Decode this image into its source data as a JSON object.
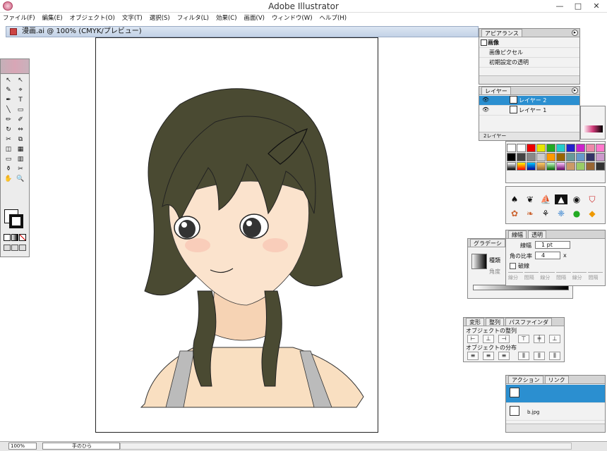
{
  "window": {
    "title": "Adobe Illustrator",
    "min": "—",
    "max": "□",
    "close": "✕"
  },
  "menu": [
    "ファイル(F)",
    "編集(E)",
    "オブジェクト(O)",
    "文字(T)",
    "選択(S)",
    "フィルタ(L)",
    "効果(C)",
    "画面(V)",
    "ウィンドウ(W)",
    "ヘルプ(H)"
  ],
  "document": {
    "tab_title": "漫画.ai @ 100% (CMYK/プレビュー)"
  },
  "status": {
    "zoom": "100%",
    "tool": "手のひら"
  },
  "toolbox": {
    "tools": [
      "↖",
      "↖",
      "✎",
      "⌖",
      "✒",
      "T",
      "╲",
      "▭",
      "✏",
      "✐",
      "↻",
      "⇔",
      "✂",
      "⧉",
      "◫",
      "▦",
      "▭",
      "▥",
      "⚱",
      "✂",
      "✋",
      "🔍"
    ]
  },
  "appearance": {
    "tab": "アピアランス",
    "title": "画像",
    "rows": [
      "画像ピクセル",
      "初期設定の透明"
    ]
  },
  "layers": {
    "tab": "レイヤー",
    "items": [
      "レイヤー 2",
      "レイヤー 1"
    ],
    "footer": "2レイヤー"
  },
  "stroke": {
    "tabs": [
      "線幅",
      "透明"
    ],
    "weight_label": "線幅",
    "weight_value": "1 pt",
    "miter_label": "角の比率",
    "miter_value": "4",
    "miter_unit": "x",
    "dashed_label": "破線",
    "dash_labels": [
      "線分",
      "間隔",
      "線分",
      "間隔",
      "線分",
      "間隔"
    ]
  },
  "gradient": {
    "tab": "グラデーシ",
    "type_label": "種類",
    "angle_label": "角度"
  },
  "align": {
    "tabs": [
      "変形",
      "整列",
      "パスファインダ"
    ],
    "section1": "オブジェクトの整列",
    "section2": "オブジェクトの分布"
  },
  "actions": {
    "tabs": [
      "アクション",
      "リンク"
    ],
    "file": "b.jpg"
  },
  "colors": {
    "brand": "#c8577a",
    "selection": "#2b8fd0",
    "hair": "#4a4a32",
    "skin": "#f9dfc1"
  }
}
